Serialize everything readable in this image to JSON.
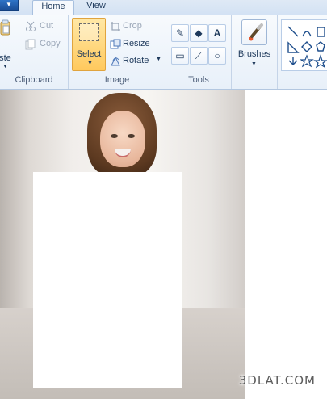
{
  "tabs": {
    "home": "Home",
    "view": "View"
  },
  "clipboard": {
    "paste_label": "aste",
    "cut_label": "Cut",
    "copy_label": "Copy",
    "group_label": "Clipboard"
  },
  "image": {
    "select_label": "Select",
    "crop_label": "Crop",
    "resize_label": "Resize",
    "rotate_label": "Rotate",
    "group_label": "Image"
  },
  "tools": {
    "group_label": "Tools",
    "text_tool_glyph": "A"
  },
  "brushes": {
    "label": "Brushes"
  },
  "watermark": "3DLAT.COM",
  "colors": {
    "ribbon_top": "#f7fafd",
    "ribbon_bottom": "#e8f0f9",
    "select_highlight": "#ffc95d",
    "tab_text": "#1e395b"
  },
  "icons": [
    "file-menu-icon",
    "paste-icon",
    "cut-icon",
    "copy-icon",
    "select-icon",
    "crop-icon",
    "resize-icon",
    "rotate-icon",
    "pencil-icon",
    "fill-icon",
    "text-icon",
    "eraser-icon",
    "color-picker-icon",
    "magnifier-icon",
    "brushes-icon",
    "shapes-icon"
  ]
}
